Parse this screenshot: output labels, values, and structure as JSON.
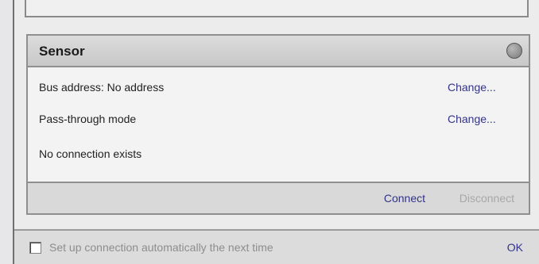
{
  "sensor": {
    "title": "Sensor",
    "status_icon": "status-circle-icon",
    "bus_address_label": "Bus address: No address",
    "bus_address_action": "Change...",
    "mode_label": "Pass-through mode",
    "mode_action": "Change...",
    "connection_status": "No connection exists",
    "connect_label": "Connect",
    "disconnect_label": "Disconnect"
  },
  "footer": {
    "auto_connect_label": "Set up connection automatically the next time",
    "auto_connect_checked": false,
    "ok_label": "OK"
  },
  "colors": {
    "link": "#33338a",
    "disabled": "#a8a8a8",
    "panel_header": "#cfcfcf"
  }
}
